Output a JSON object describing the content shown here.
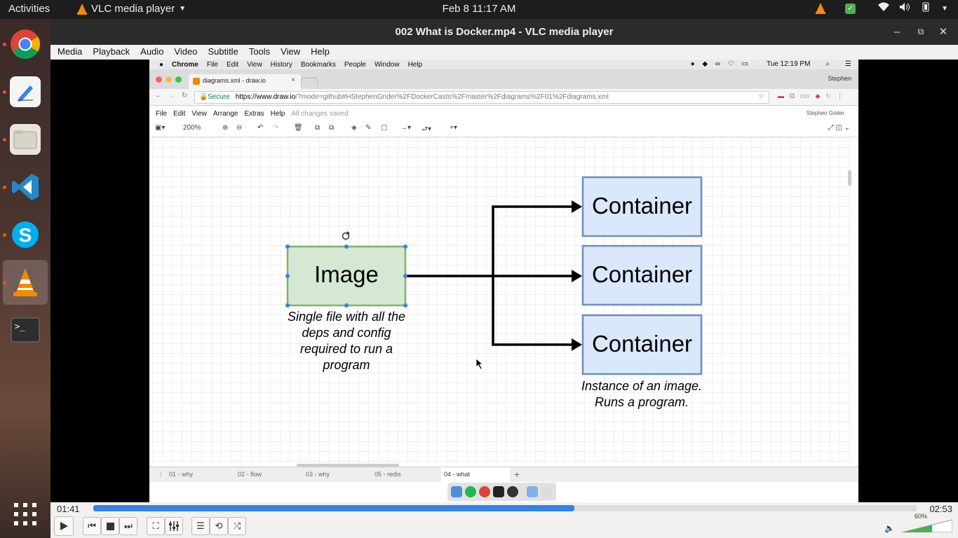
{
  "topbar": {
    "activities": "Activities",
    "app_name": "VLC media player",
    "clock": "Feb 8  11:17 AM"
  },
  "dock": {
    "items": [
      "chrome-icon",
      "text-editor-icon",
      "files-icon",
      "vscode-icon",
      "skype-icon",
      "vlc-icon",
      "terminal-icon"
    ],
    "apps_grid": "show-applications-icon"
  },
  "window": {
    "title": "002 What is Docker.mp4 - VLC media player"
  },
  "menu": {
    "items": [
      "Media",
      "Playback",
      "Audio",
      "Video",
      "Subtitle",
      "Tools",
      "View",
      "Help"
    ]
  },
  "video": {
    "mac_menubar": {
      "app": "Chrome",
      "items": [
        "File",
        "Edit",
        "View",
        "History",
        "Bookmarks",
        "People",
        "Window",
        "Help"
      ],
      "clock": "Tue 12:19 PM"
    },
    "chrome": {
      "tab_title": "diagrams.xml - draw.io",
      "profile": "Stephen",
      "secure": "Secure",
      "url_host": "https://www.draw.io",
      "url_rest": "/?mode=github#HStephenGrider%2FDockerCasts%2Fmaster%2Fdiagrams%2F01%2Fdiagrams.xml"
    },
    "drawio": {
      "menu": [
        "File",
        "Edit",
        "View",
        "Arrange",
        "Extras",
        "Help"
      ],
      "saved": "All changes saved",
      "user": "Stephen Grider",
      "zoom": "200%",
      "pages": [
        "01 - why",
        "02 - flow",
        "03 - why",
        "05 - redis",
        "04 - what"
      ]
    },
    "diagram": {
      "image_label": "Image",
      "image_caption_lines": [
        "Single file with all the",
        "deps and config",
        "required to run a",
        "program"
      ],
      "container_labels": [
        "Container",
        "Container",
        "Container"
      ],
      "container_caption_lines": [
        "Instance of an image.",
        "Runs a program."
      ],
      "colors": {
        "image_fill": "#d5e8d4",
        "image_stroke": "#82b366",
        "container_fill": "#dae8fc",
        "container_stroke": "#6c8ebf",
        "selection": "#3584e4"
      }
    }
  },
  "controls": {
    "elapsed": "01:41",
    "total": "02:53",
    "progress": 0.584,
    "volume_label": "60%",
    "volume": 0.6
  }
}
